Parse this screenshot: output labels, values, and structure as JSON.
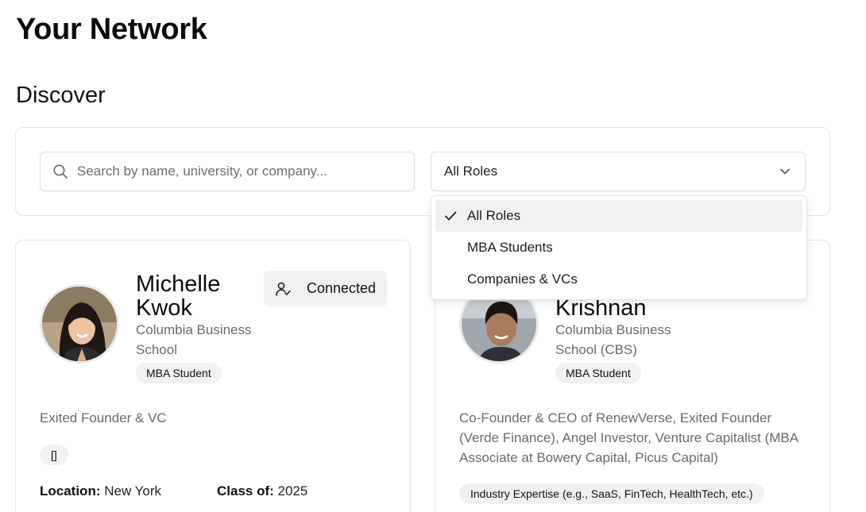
{
  "header": {
    "title": "Your Network"
  },
  "discover": {
    "title": "Discover"
  },
  "filters": {
    "search_placeholder": "Search by name, university, or company...",
    "role_selected": "All Roles",
    "role_options": [
      {
        "label": "All Roles",
        "selected": true
      },
      {
        "label": "MBA Students",
        "selected": false
      },
      {
        "label": "Companies & VCs",
        "selected": false
      }
    ]
  },
  "cards": [
    {
      "name_line1": "Michelle",
      "name_line2": "Kwok",
      "school": "Columbia Business School",
      "badge": "MBA Student",
      "action": "Connected",
      "bio": "Exited Founder & VC",
      "tag": "[]",
      "location_label": "Location:",
      "location": "New York",
      "class_label": "Class of:",
      "class_year": "2025"
    },
    {
      "name_line2": "Krishnan",
      "school": "Columbia Business School (CBS)",
      "badge": "MBA Student",
      "bio": "Co-Founder & CEO of RenewVerse, Exited Founder (Verde Finance), Angel Investor, Venture Capitalist (MBA Associate at Bowery Capital, Picus Capital)",
      "tag": "Industry Expertise (e.g., SaaS, FinTech, HealthTech, etc.)"
    }
  ],
  "colors": {
    "text": "#111111",
    "muted": "#6a6a6a",
    "chip_bg": "#f1f1f1",
    "border": "#e3e3e3"
  },
  "icons": [
    "search-icon",
    "chevron-down-icon",
    "check-icon",
    "user-check-icon"
  ]
}
